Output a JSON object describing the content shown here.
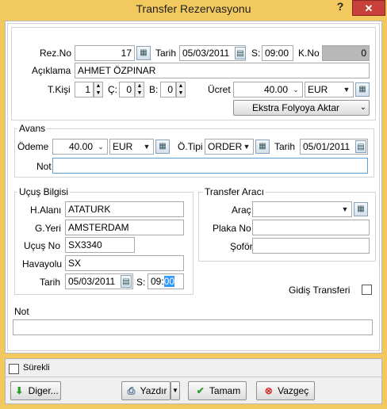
{
  "window": {
    "title": "Transfer Rezervasyonu",
    "help": "?",
    "close": "✕"
  },
  "rez": {
    "rez_no_label": "Rez.No",
    "rez_no": "17",
    "tarih_label": "Tarih",
    "tarih": "05/03/2011",
    "s_label": "S:",
    "saat": "09:00",
    "kno_label": "K.No",
    "kno": "0",
    "aciklama_label": "Açıklama",
    "aciklama": "AHMET ÖZPINAR",
    "tkisi_label": "T.Kişi",
    "tkisi": "1",
    "c_label": "Ç:",
    "c": "0",
    "b_label": "B:",
    "b": "0",
    "ucret_label": "Ücret",
    "ucret": "40.00",
    "ucret_currency": "EUR",
    "ekstra_button": "Ekstra Folyoya Aktar"
  },
  "avans": {
    "title": "Avans",
    "odeme_label": "Ödeme",
    "odeme": "40.00",
    "odeme_currency": "EUR",
    "otipi_label": "Ö.Tipi",
    "otipi": "ORDER",
    "tarih_label": "Tarih",
    "tarih": "05/01/2011",
    "not_label": "Not",
    "not": ""
  },
  "ucus": {
    "title": "Uçuş Bilgisi",
    "halani_label": "H.Alanı",
    "halani": "ATATURK",
    "gyeri_label": "G.Yeri",
    "gyeri": "AMSTERDAM",
    "ucusno_label": "Uçuş No",
    "ucusno": "SX3340",
    "havayolu_label": "Havayolu",
    "havayolu": "SX",
    "tarih_label": "Tarih",
    "tarih": "05/03/2011",
    "s_label": "S:",
    "saat_hh": "09:",
    "saat_mm": "00"
  },
  "arac": {
    "title": "Transfer Aracı",
    "arac_label": "Araç",
    "arac": "",
    "plaka_label": "Plaka No",
    "plaka": "",
    "sofor_label": "Şoför",
    "sofor": ""
  },
  "gidis": {
    "label": "Gidiş Transferi"
  },
  "not": {
    "label": "Not",
    "value": ""
  },
  "bottom": {
    "surekli_label": "Sürekli",
    "diger_button": "Diger...",
    "yazdir_button": "Yazdır",
    "tamam_button": "Tamam",
    "vazgec_button": "Vazgeç"
  },
  "colors": {
    "title_bar": "#f2c95e",
    "close": "#c7403a",
    "focus_border": "#5aa0d8"
  }
}
